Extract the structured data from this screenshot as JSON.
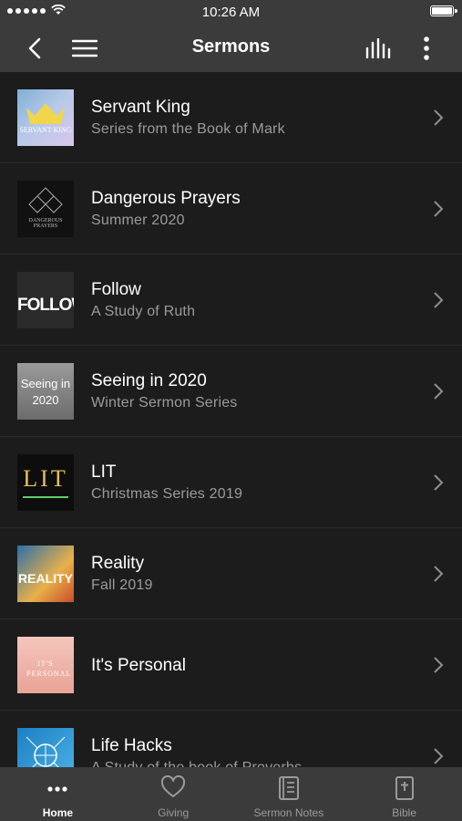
{
  "status": {
    "time": "10:26 AM"
  },
  "nav": {
    "title": "Sermons"
  },
  "sermons": [
    {
      "title": "Servant King",
      "subtitle": "Series from the Book of Mark",
      "thumb_text": "SERVANT KING"
    },
    {
      "title": "Dangerous Prayers",
      "subtitle": "Summer 2020",
      "thumb_text": "DANGEROUS PRAYERS"
    },
    {
      "title": "Follow",
      "subtitle": "A Study of Ruth",
      "thumb_text": "FOLLOW"
    },
    {
      "title": "Seeing in 2020",
      "subtitle": "Winter Sermon Series",
      "thumb_text": "Seeing in 2020"
    },
    {
      "title": "LIT",
      "subtitle": "Christmas Series 2019",
      "thumb_text": "LIT"
    },
    {
      "title": "Reality",
      "subtitle": "Fall 2019",
      "thumb_text": "REALITY"
    },
    {
      "title": "It's Personal",
      "subtitle": "",
      "thumb_text": "IT'S PERSONAL"
    },
    {
      "title": "Life Hacks",
      "subtitle": "A Study of the book of Proverbs",
      "thumb_text": ""
    }
  ],
  "tabs": [
    {
      "label": "Home",
      "icon": "more-dots-icon",
      "active": true
    },
    {
      "label": "Giving",
      "icon": "heart-icon",
      "active": false
    },
    {
      "label": "Sermon Notes",
      "icon": "notes-icon",
      "active": false
    },
    {
      "label": "Bible",
      "icon": "bible-icon",
      "active": false
    }
  ],
  "colors": {
    "bar": "#3b3b3c",
    "background": "#1c1c1d",
    "subtitle": "#9b9b9b"
  }
}
